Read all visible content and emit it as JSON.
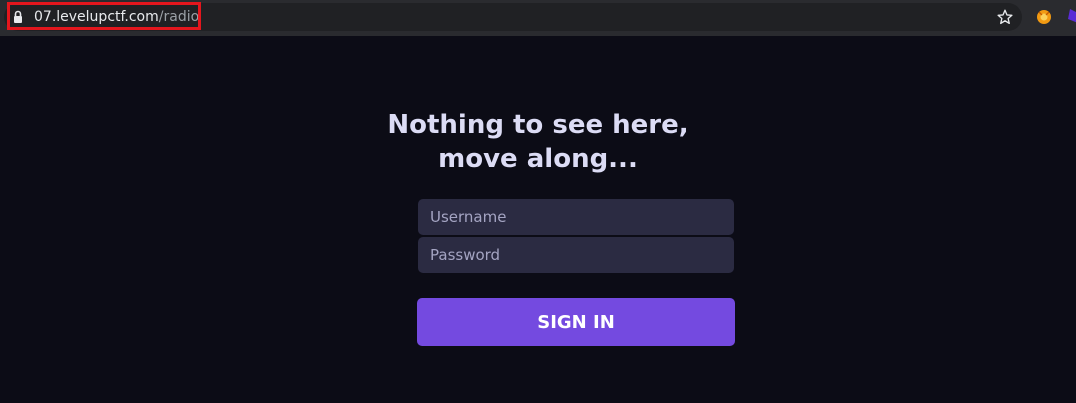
{
  "browser": {
    "url_domain": "07.levelupctf.com",
    "url_path": "/radio",
    "icons": [
      "lock-icon",
      "star-icon",
      "extension-icon"
    ],
    "highlight_color": "#e3161d"
  },
  "page": {
    "title_line1": "Nothing to see here,",
    "title_line2": "move along...",
    "username_placeholder": "Username",
    "password_placeholder": "Password",
    "signin_label": "SIGN IN",
    "accent_color": "#744ae0",
    "background_color": "#0c0c16"
  }
}
